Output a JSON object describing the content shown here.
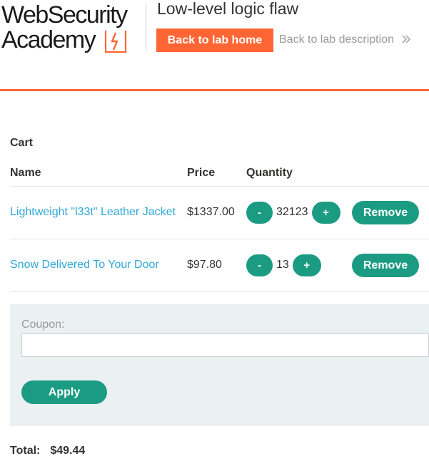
{
  "header": {
    "logo_line1": "WebSecurity",
    "logo_line2": "Academy",
    "lab_title": "Low-level logic flaw",
    "back_home_label": "Back to lab home",
    "back_description_label": "Back to lab description",
    "accent_color": "#ff6633"
  },
  "cart": {
    "heading": "Cart",
    "columns": [
      "Name",
      "Price",
      "Quantity"
    ],
    "items": [
      {
        "name": "Lightweight \"l33t\" Leather Jacket",
        "price": "$1337.00",
        "minus_label": "-",
        "quantity": "32123",
        "plus_label": "+",
        "remove_label": "Remove"
      },
      {
        "name": "Snow Delivered To Your Door",
        "price": "$97.80",
        "minus_label": "-",
        "quantity": "13",
        "plus_label": "+",
        "remove_label": "Remove"
      }
    ],
    "button_color": "#1b9c82"
  },
  "coupon": {
    "label": "Coupon:",
    "value": "",
    "apply_label": "Apply"
  },
  "total": {
    "label": "Total:",
    "value": "$49.44"
  }
}
